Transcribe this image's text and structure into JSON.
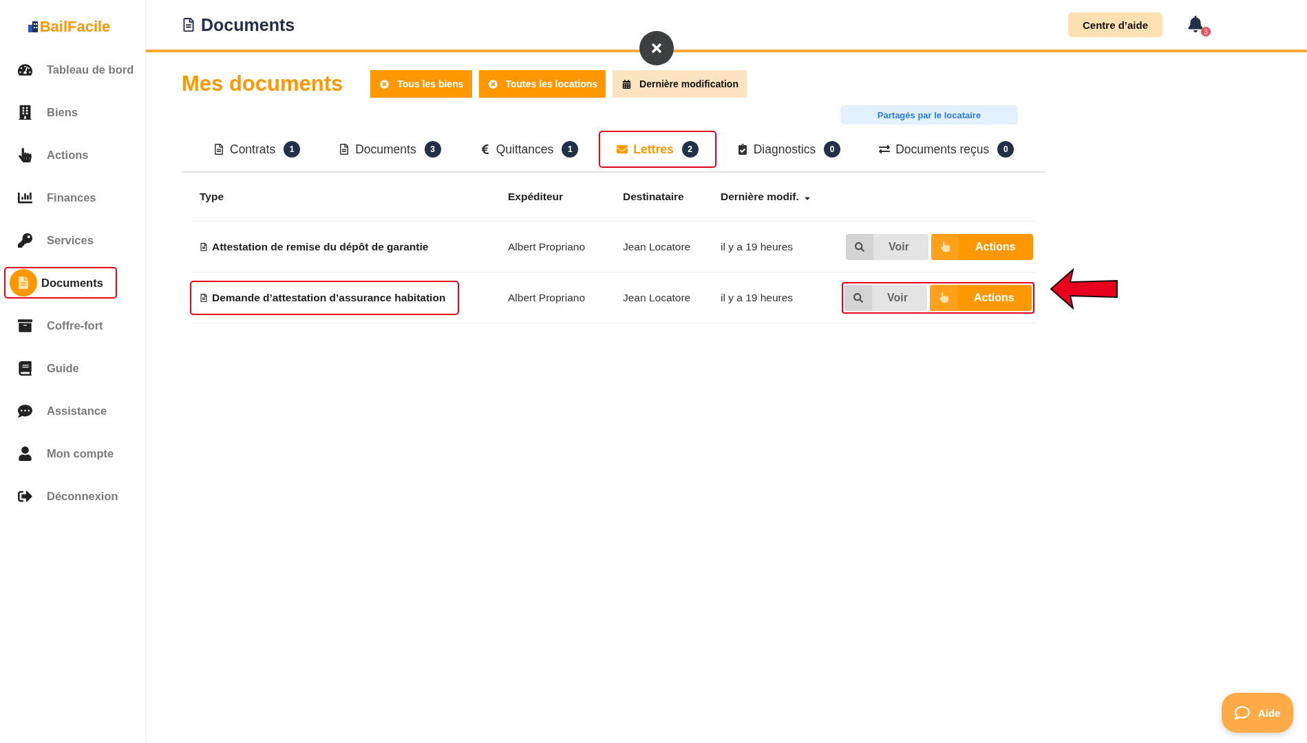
{
  "logo": "BailFacile",
  "sidebar": {
    "items": [
      {
        "label": "Tableau de bord",
        "selected": false,
        "highlighted": false
      },
      {
        "label": "Biens",
        "selected": false,
        "highlighted": false
      },
      {
        "label": "Actions",
        "selected": false,
        "highlighted": false
      },
      {
        "label": "Finances",
        "selected": false,
        "highlighted": false
      },
      {
        "label": "Services",
        "selected": false,
        "highlighted": false
      },
      {
        "label": "Documents",
        "selected": true,
        "highlighted": true
      },
      {
        "label": "Coffre-fort",
        "selected": false,
        "highlighted": false
      },
      {
        "label": "Guide",
        "selected": false,
        "highlighted": false
      },
      {
        "label": "Assistance",
        "selected": false,
        "highlighted": false
      },
      {
        "label": "Mon compte",
        "selected": false,
        "highlighted": false
      },
      {
        "label": "Déconnexion",
        "selected": false,
        "highlighted": false
      }
    ]
  },
  "header": {
    "title": "Documents",
    "help_button": "Centre d’aide",
    "notification_count": "3"
  },
  "page": {
    "title": "Mes documents",
    "filters": [
      {
        "label": "Tous les biens",
        "kind": "clear"
      },
      {
        "label": "Toutes les locations",
        "kind": "clear"
      },
      {
        "label": "Dernière modification",
        "kind": "sort"
      }
    ],
    "shared_note": "Partagés par le locataire"
  },
  "tabs": [
    {
      "label": "Contrats",
      "count": "1",
      "selected": false,
      "highlighted": false
    },
    {
      "label": "Documents",
      "count": "3",
      "selected": false,
      "highlighted": false
    },
    {
      "label": "Quittances",
      "count": "1",
      "selected": false,
      "highlighted": false
    },
    {
      "label": "Lettres",
      "count": "2",
      "selected": true,
      "highlighted": true
    },
    {
      "label": "Diagnostics",
      "count": "0",
      "selected": false,
      "highlighted": false
    },
    {
      "label": "Documents reçus",
      "count": "0",
      "selected": false,
      "highlighted": false
    }
  ],
  "table": {
    "columns": [
      {
        "label": "Type",
        "sorted": false
      },
      {
        "label": "Expéditeur",
        "sorted": false
      },
      {
        "label": "Destinataire",
        "sorted": false
      },
      {
        "label": "Dernière modif.",
        "sorted": true
      }
    ],
    "rows": [
      {
        "type": "Attestation de remise du dépôt de garantie",
        "sender": "Albert Propriano",
        "recipient": "Jean Locatore",
        "modified": "il y a 19 heures",
        "view_button": "Voir",
        "actions_button": "Actions",
        "type_highlighted": false,
        "buttons_highlighted": false
      },
      {
        "type": "Demande d’attestation d’assurance habitation",
        "sender": "Albert Propriano",
        "recipient": "Jean Locatore",
        "modified": "il y a 19 heures",
        "view_button": "Voir",
        "actions_button": "Actions",
        "type_highlighted": true,
        "buttons_highlighted": true
      }
    ]
  },
  "help_widget": {
    "label": "Aide"
  }
}
